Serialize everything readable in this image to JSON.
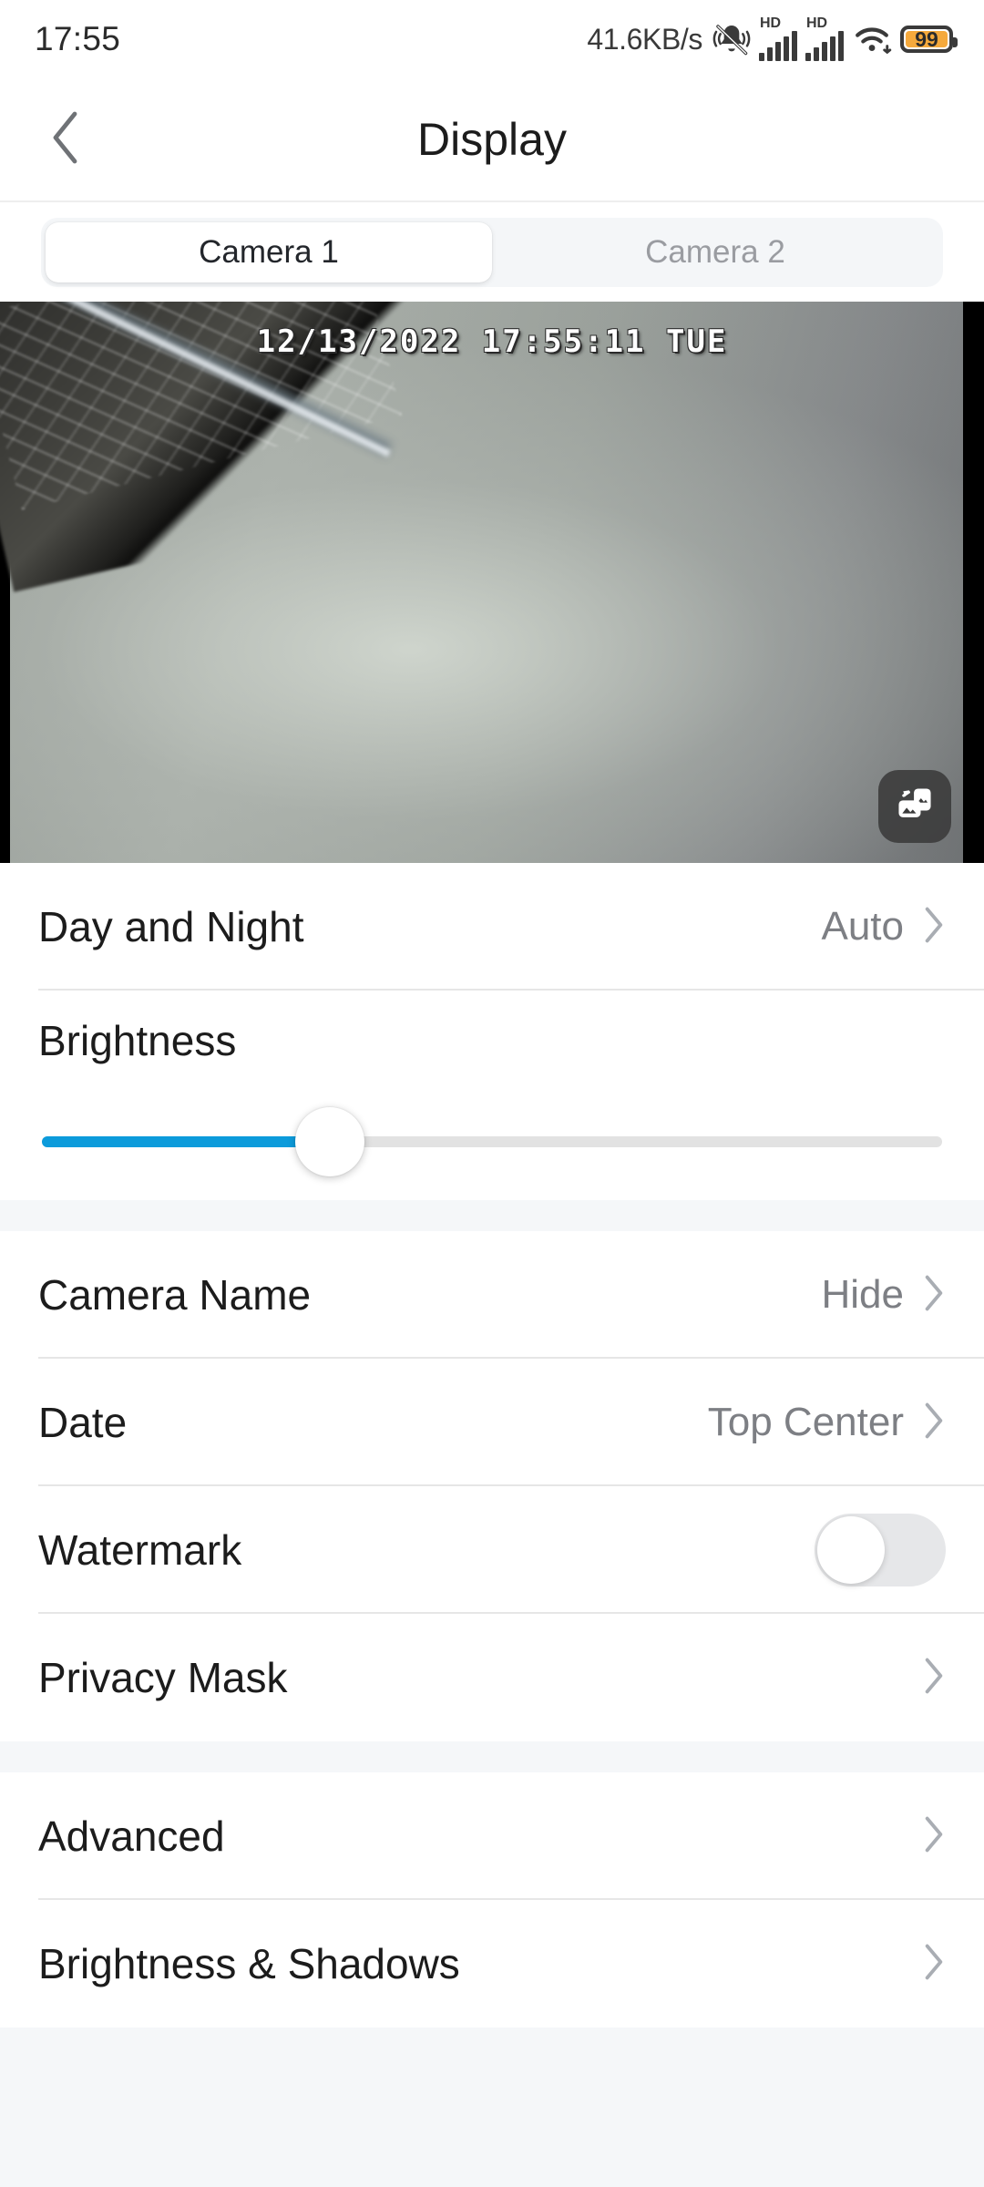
{
  "status_bar": {
    "clock": "17:55",
    "network_speed": "41.6KB/s",
    "silent_icon": "bell-mute-icon",
    "signal_1_label": "HD",
    "signal_2_label": "HD",
    "wifi_icon": "wifi-icon",
    "battery_level": "99"
  },
  "header": {
    "back_icon": "back-chevron-icon",
    "title": "Display"
  },
  "tabs": {
    "items": [
      {
        "label": "Camera 1",
        "active": true
      },
      {
        "label": "Camera 2",
        "active": false
      }
    ]
  },
  "video": {
    "osd_timestamp": "12/13/2022 17:55:11 TUE",
    "fullscreen_icon": "rotate-orientation-icon"
  },
  "sections": [
    {
      "rows": [
        {
          "label": "Day and Night",
          "value": "Auto",
          "control": "chevron"
        }
      ],
      "slider": {
        "label": "Brightness",
        "value_percent": 32,
        "fill_color": "#0c9bdb",
        "track_color": "#e2e2e2"
      }
    },
    {
      "rows": [
        {
          "label": "Camera Name",
          "value": "Hide",
          "control": "chevron"
        },
        {
          "label": "Date",
          "value": "Top Center",
          "control": "chevron"
        },
        {
          "label": "Watermark",
          "value": "",
          "control": "toggle",
          "toggle_on": false
        },
        {
          "label": "Privacy Mask",
          "value": "",
          "control": "chevron"
        }
      ]
    },
    {
      "rows": [
        {
          "label": "Advanced",
          "value": "",
          "control": "chevron"
        },
        {
          "label": "Brightness & Shadows",
          "value": "",
          "control": "chevron"
        }
      ]
    }
  ]
}
